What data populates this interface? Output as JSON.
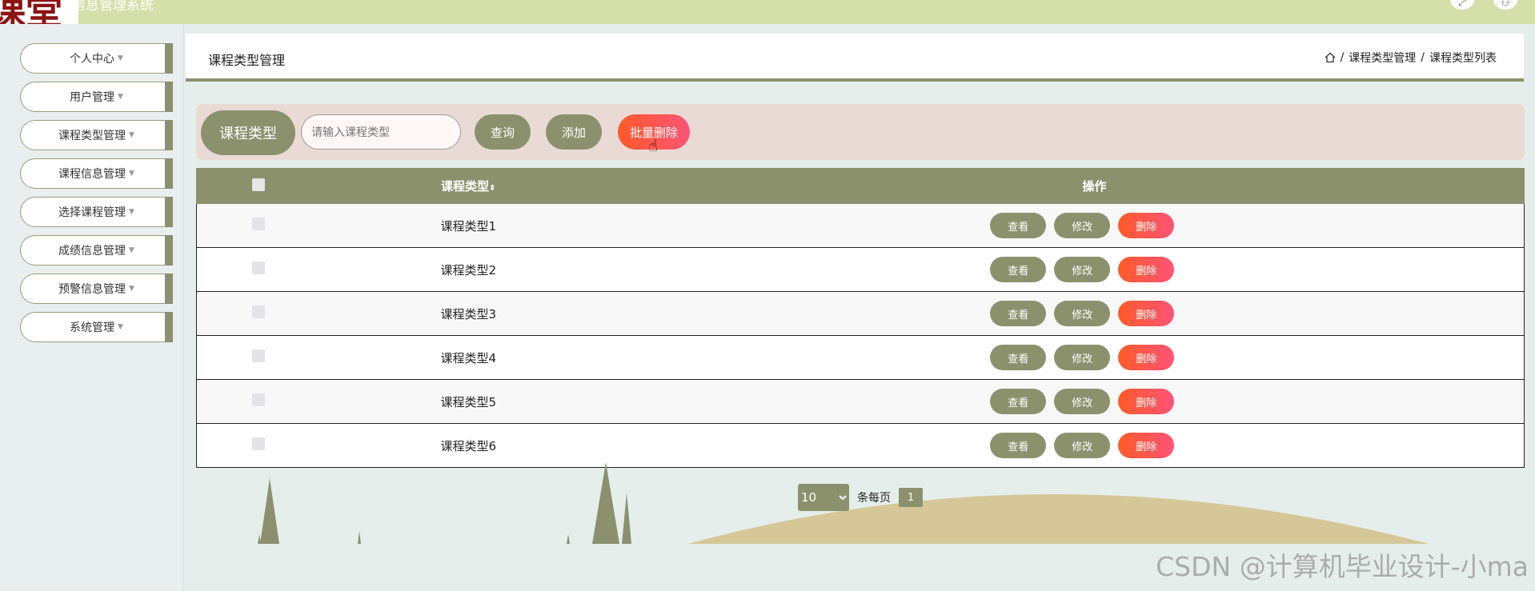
{
  "app": {
    "title": "信息管理系统",
    "logo_text": "课堂"
  },
  "sidebar": {
    "items": [
      {
        "label": "个人中心"
      },
      {
        "label": "用户管理"
      },
      {
        "label": "课程类型管理"
      },
      {
        "label": "课程信息管理"
      },
      {
        "label": "选择课程管理"
      },
      {
        "label": "成绩信息管理"
      },
      {
        "label": "预警信息管理"
      },
      {
        "label": "系统管理"
      }
    ]
  },
  "header": {
    "title": "课程类型管理",
    "breadcrumb": [
      "课程类型管理",
      "课程类型列表"
    ]
  },
  "search": {
    "label": "课程类型",
    "placeholder": "请输入课程类型",
    "value": "",
    "query_label": "查询",
    "add_label": "添加",
    "batch_delete_label": "批量删除"
  },
  "table": {
    "headers": {
      "type": "课程类型",
      "ops": "操作"
    },
    "rows": [
      {
        "type": "课程类型1"
      },
      {
        "type": "课程类型2"
      },
      {
        "type": "课程类型3"
      },
      {
        "type": "课程类型4"
      },
      {
        "type": "课程类型5"
      },
      {
        "type": "课程类型6"
      }
    ],
    "actions": {
      "view": "查看",
      "edit": "修改",
      "delete": "删除"
    }
  },
  "pagination": {
    "page_size": "10",
    "per_page_label": "条每页",
    "current_page": "1"
  },
  "watermark": "CSDN @计算机毕业设计-小ma",
  "colors": {
    "primary": "#8b916d",
    "danger": "#ff5a36",
    "topbar": "#d4dfa9",
    "search_bar": "#eadad6",
    "page_bg": "#e6eeec"
  }
}
